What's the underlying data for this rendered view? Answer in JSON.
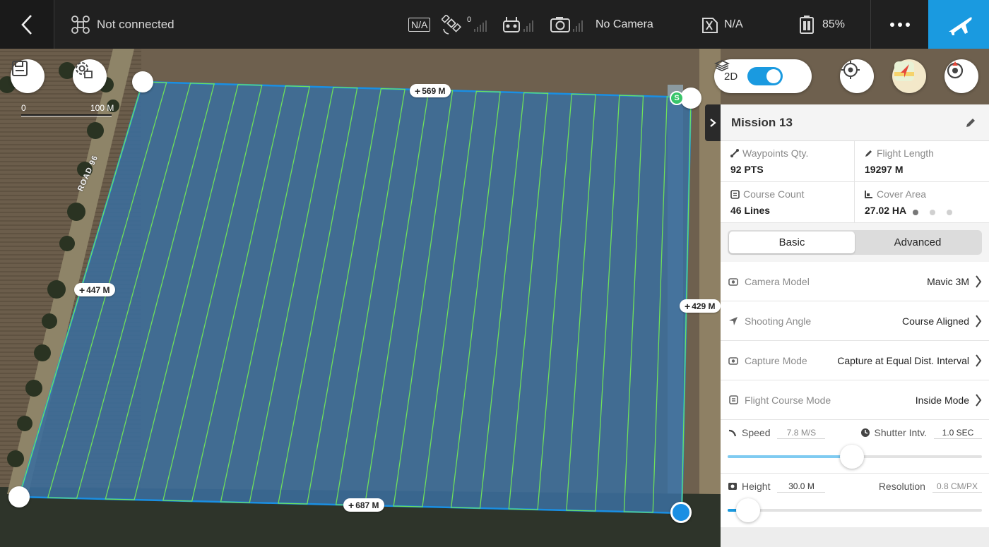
{
  "topbar": {
    "connection": "Not connected",
    "na_badge": "N/A",
    "satellite_count": "0",
    "camera_status": "No Camera",
    "storage_status": "N/A",
    "battery": "85%",
    "icons": [
      "back-icon",
      "drone-icon",
      "satellite-icon",
      "remote-controller-icon",
      "camera-icon",
      "storage-icon",
      "battery-icon",
      "more-icon",
      "takeoff-plane-icon"
    ]
  },
  "map": {
    "view_mode": "2D",
    "view_toggle_on": true,
    "scale_min": "0",
    "scale_max": "100 M",
    "road_label": "ROAD 96",
    "edges": {
      "top": "569 M",
      "left": "447 M",
      "right": "429 M",
      "bottom": "687 M"
    },
    "start_marker": "S",
    "colors": {
      "boundary": "#1a8fe3",
      "flight_lines": "#6fe05a",
      "area_fill": "#3b6d9c",
      "accent": "#1a9ae0"
    }
  },
  "panel": {
    "mission_name": "Mission 13",
    "stats": {
      "waypoints": {
        "label": "Waypoints Qty.",
        "value": "92 PTS"
      },
      "flight_length": {
        "label": "Flight Length",
        "value": "19297 M"
      },
      "course_count": {
        "label": "Course Count",
        "value": "46 Lines"
      },
      "cover_area": {
        "label": "Cover Area",
        "value": "27.02 HA"
      }
    },
    "page_dots": 3,
    "active_dot": 0,
    "tabs": {
      "basic": "Basic",
      "advanced": "Advanced",
      "active": "basic"
    },
    "settings": {
      "camera_model": {
        "label": "Camera Model",
        "value": "Mavic 3M"
      },
      "shooting_angle": {
        "label": "Shooting Angle",
        "value": "Course Aligned"
      },
      "capture_mode": {
        "label": "Capture Mode",
        "value": "Capture at Equal Dist. Interval"
      },
      "flight_course_mode": {
        "label": "Flight Course Mode",
        "value": "Inside Mode"
      }
    },
    "speed": {
      "label": "Speed",
      "value": "7.8 M/S",
      "level": 0.49
    },
    "shutter": {
      "label": "Shutter Intv.",
      "value": "1.0 SEC"
    },
    "height": {
      "label": "Height",
      "value": "30.0 M",
      "level": 0.08
    },
    "resolution": {
      "label": "Resolution",
      "value": "0.8 CM/PX"
    }
  }
}
